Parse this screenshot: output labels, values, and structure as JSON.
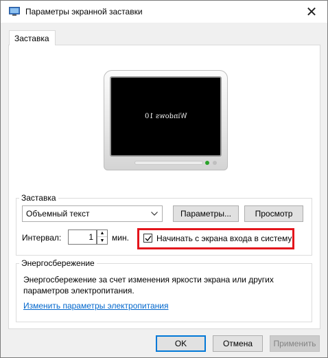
{
  "window": {
    "title": "Параметры экранной заставки",
    "close_glyph": "✕"
  },
  "tabs": [
    {
      "label": "Заставка",
      "active": true
    }
  ],
  "preview": {
    "screen_text": "Windows 10"
  },
  "screensaver": {
    "group_label": "Заставка",
    "selected": "Объемный текст",
    "settings_button": "Параметры...",
    "preview_button": "Просмотр",
    "interval_label": "Интервал:",
    "interval_value": "1",
    "interval_unit": "мин.",
    "logon_checkbox_label": "Начинать с экрана входа в систему",
    "logon_checked": true
  },
  "power": {
    "group_label": "Энергосбережение",
    "description": "Энергосбережение за счет изменения яркости экрана или других параметров электропитания.",
    "link": "Изменить параметры электропитания"
  },
  "footer": {
    "ok": "OK",
    "cancel": "Отмена",
    "apply": "Применить"
  },
  "colors": {
    "highlight": "#e3141b",
    "link": "#0066cc",
    "focus": "#0078d7"
  }
}
